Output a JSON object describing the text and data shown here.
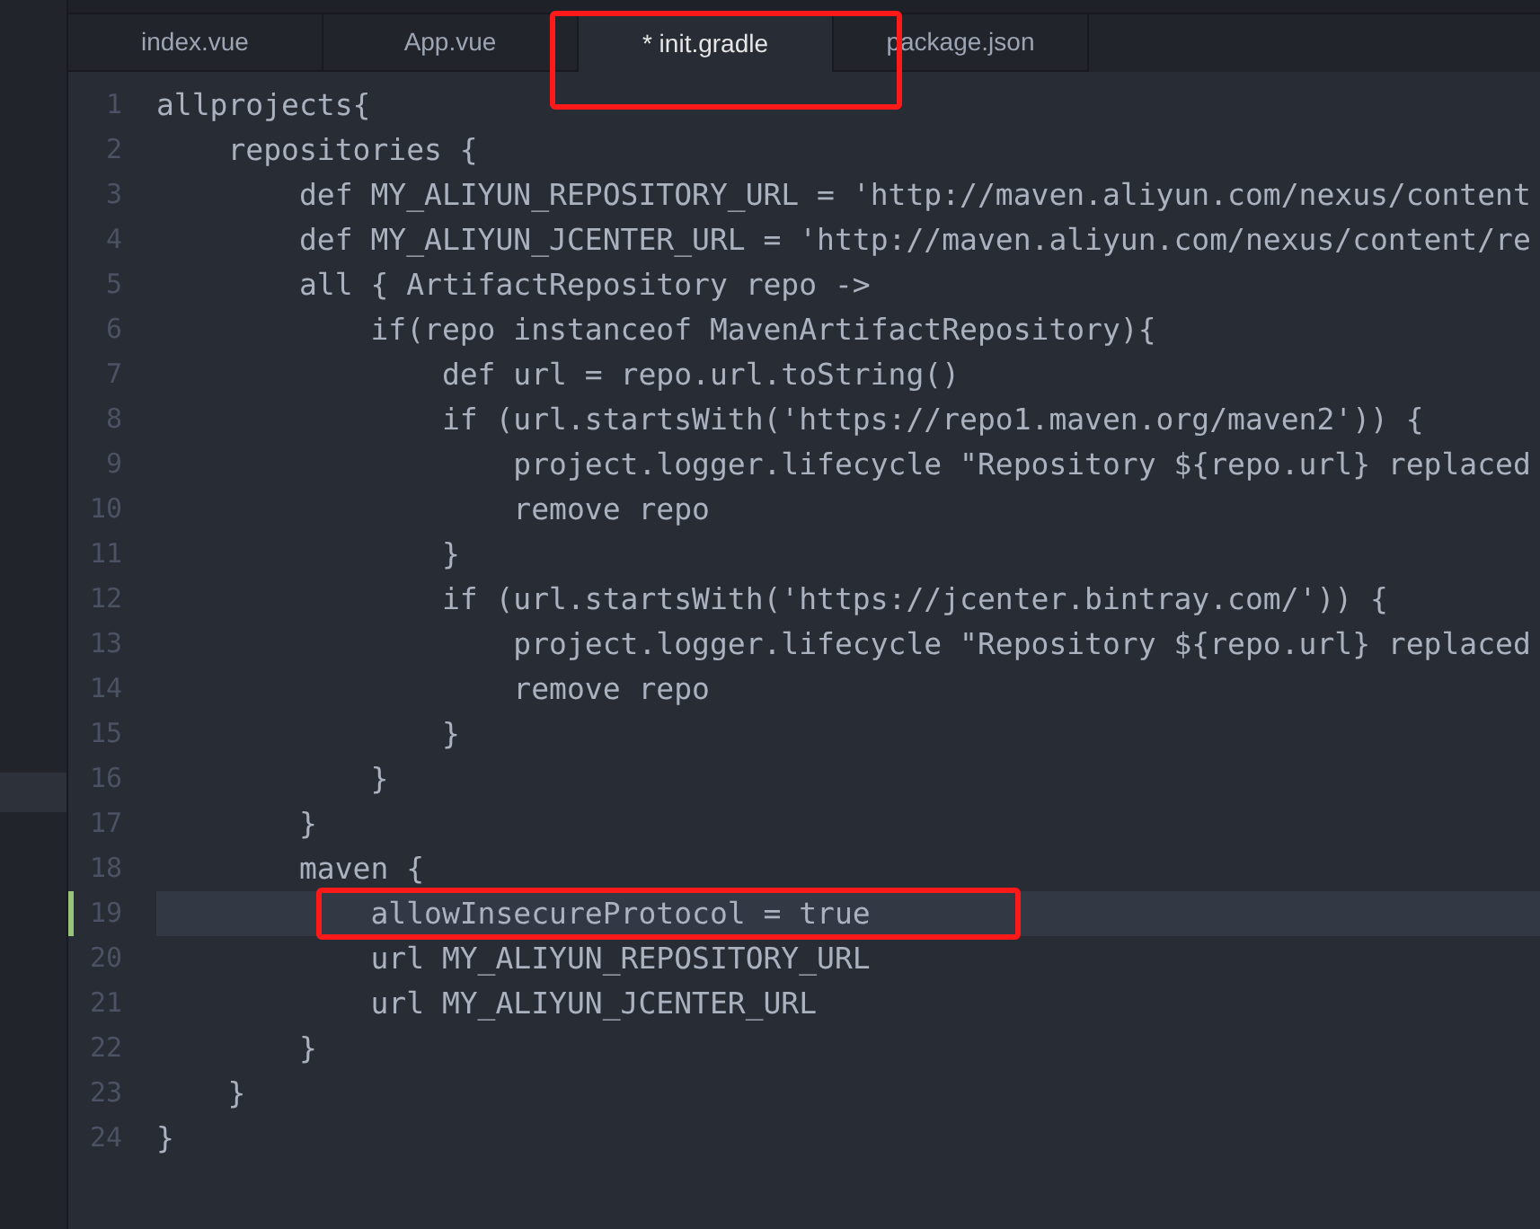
{
  "tabs": [
    {
      "label": "index.vue",
      "selected": false,
      "highlighted": false
    },
    {
      "label": "App.vue",
      "selected": false,
      "highlighted": false
    },
    {
      "label": "* init.gradle",
      "selected": true,
      "highlighted": true
    },
    {
      "label": "package.json",
      "selected": false,
      "highlighted": false
    }
  ],
  "editor": {
    "lines": [
      {
        "number": "1",
        "text": "allprojects{",
        "active": false,
        "highlighted": false
      },
      {
        "number": "2",
        "text": "    repositories {",
        "active": false,
        "highlighted": false
      },
      {
        "number": "3",
        "text": "        def MY_ALIYUN_REPOSITORY_URL = 'http://maven.aliyun.com/nexus/content",
        "active": false,
        "highlighted": false
      },
      {
        "number": "4",
        "text": "        def MY_ALIYUN_JCENTER_URL = 'http://maven.aliyun.com/nexus/content/re",
        "active": false,
        "highlighted": false
      },
      {
        "number": "5",
        "text": "        all { ArtifactRepository repo ->",
        "active": false,
        "highlighted": false
      },
      {
        "number": "6",
        "text": "            if(repo instanceof MavenArtifactRepository){",
        "active": false,
        "highlighted": false
      },
      {
        "number": "7",
        "text": "                def url = repo.url.toString()",
        "active": false,
        "highlighted": false
      },
      {
        "number": "8",
        "text": "                if (url.startsWith('https://repo1.maven.org/maven2')) {",
        "active": false,
        "highlighted": false
      },
      {
        "number": "9",
        "text": "                    project.logger.lifecycle \"Repository ${repo.url} replaced",
        "active": false,
        "highlighted": false
      },
      {
        "number": "10",
        "text": "                    remove repo",
        "active": false,
        "highlighted": false
      },
      {
        "number": "11",
        "text": "                }",
        "active": false,
        "highlighted": false
      },
      {
        "number": "12",
        "text": "                if (url.startsWith('https://jcenter.bintray.com/')) {",
        "active": false,
        "highlighted": false
      },
      {
        "number": "13",
        "text": "                    project.logger.lifecycle \"Repository ${repo.url} replaced",
        "active": false,
        "highlighted": false
      },
      {
        "number": "14",
        "text": "                    remove repo",
        "active": false,
        "highlighted": false
      },
      {
        "number": "15",
        "text": "                }",
        "active": false,
        "highlighted": false
      },
      {
        "number": "16",
        "text": "            }",
        "active": false,
        "highlighted": false
      },
      {
        "number": "17",
        "text": "        }",
        "active": false,
        "highlighted": false
      },
      {
        "number": "18",
        "text": "        maven {",
        "active": false,
        "highlighted": false
      },
      {
        "number": "19",
        "text": "            allowInsecureProtocol = true",
        "active": true,
        "highlighted": true
      },
      {
        "number": "20",
        "text": "            url MY_ALIYUN_REPOSITORY_URL",
        "active": false,
        "highlighted": false
      },
      {
        "number": "21",
        "text": "            url MY_ALIYUN_JCENTER_URL",
        "active": false,
        "highlighted": false
      },
      {
        "number": "22",
        "text": "        }",
        "active": false,
        "highlighted": false
      },
      {
        "number": "23",
        "text": "    }",
        "active": false,
        "highlighted": false
      },
      {
        "number": "24",
        "text": "}",
        "active": false,
        "highlighted": false
      }
    ]
  }
}
